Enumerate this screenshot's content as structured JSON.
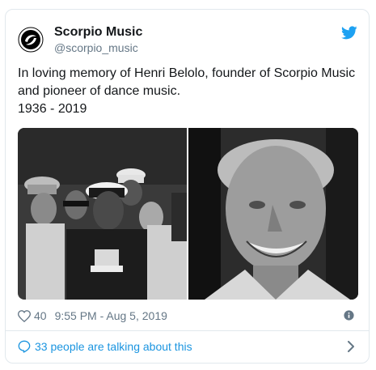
{
  "account": {
    "display_name": "Scorpio Music",
    "handle": "@scorpio_music"
  },
  "tweet": {
    "line1": "In loving memory of Henri Belolo, founder of Scorpio Music",
    "line2": "and pioneer of dance music.",
    "line3": "1936 - 2019"
  },
  "meta": {
    "likes": "40",
    "timestamp": "9:55 PM - Aug 5, 2019"
  },
  "footer": {
    "conversation": "33 people are talking about this"
  },
  "icons": [
    "scorpio-logo-icon",
    "twitter-bird-icon",
    "heart-icon",
    "info-icon",
    "speech-bubble-icon",
    "chevron-right-icon"
  ],
  "colors": {
    "link": "#1b95e0",
    "muted": "#657786",
    "twitter_blue": "#1da1f2"
  }
}
